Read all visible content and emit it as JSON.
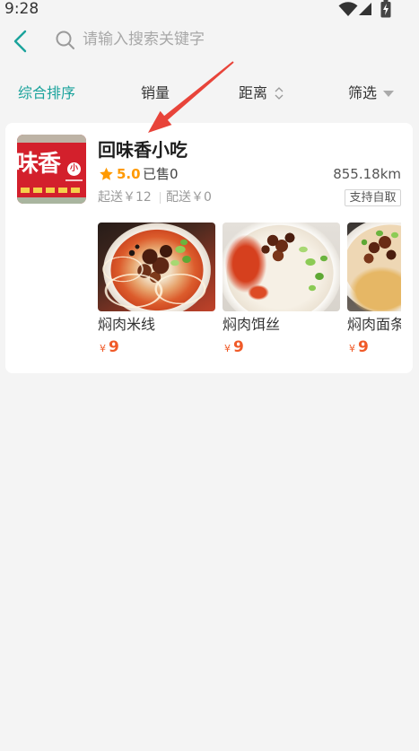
{
  "status_bar": {
    "time": "9:28",
    "icons": [
      "wifi-icon",
      "cellular-signal-icon",
      "battery-charging-icon"
    ]
  },
  "header": {
    "back_icon": "chevron-left-icon",
    "search_icon": "search-icon",
    "search_placeholder": "请输入搜索关键字"
  },
  "tabs": [
    {
      "label": "综合排序",
      "active": true
    },
    {
      "label": "销量",
      "active": false
    },
    {
      "label": "距离",
      "active": false,
      "icon": "sort-up-down-icon"
    },
    {
      "label": "筛选",
      "active": false,
      "icon": "caret-down-icon"
    }
  ],
  "store": {
    "name": "回味香小吃",
    "logo": {
      "wordmark": "味香",
      "badge": "小"
    },
    "rating_icon": "star-icon",
    "rating": "5.0",
    "sold": "已售0",
    "distance": "855.18km",
    "min_order": "起送￥12",
    "delivery_fee": "配送￥0",
    "pickup_badge": "支持自取",
    "items": [
      {
        "name": "焖肉米线",
        "currency": "¥",
        "price": "9"
      },
      {
        "name": "焖肉饵丝",
        "currency": "¥",
        "price": "9"
      },
      {
        "name": "焖肉面条",
        "currency": "¥",
        "price": "9"
      }
    ]
  },
  "colors": {
    "accent": "#1ba39c",
    "price": "#f05a28",
    "star": "#ff9a00",
    "logo_red": "#d3202c",
    "annotation_arrow": "#e8443a",
    "page_bg": "#f4f4f4"
  }
}
